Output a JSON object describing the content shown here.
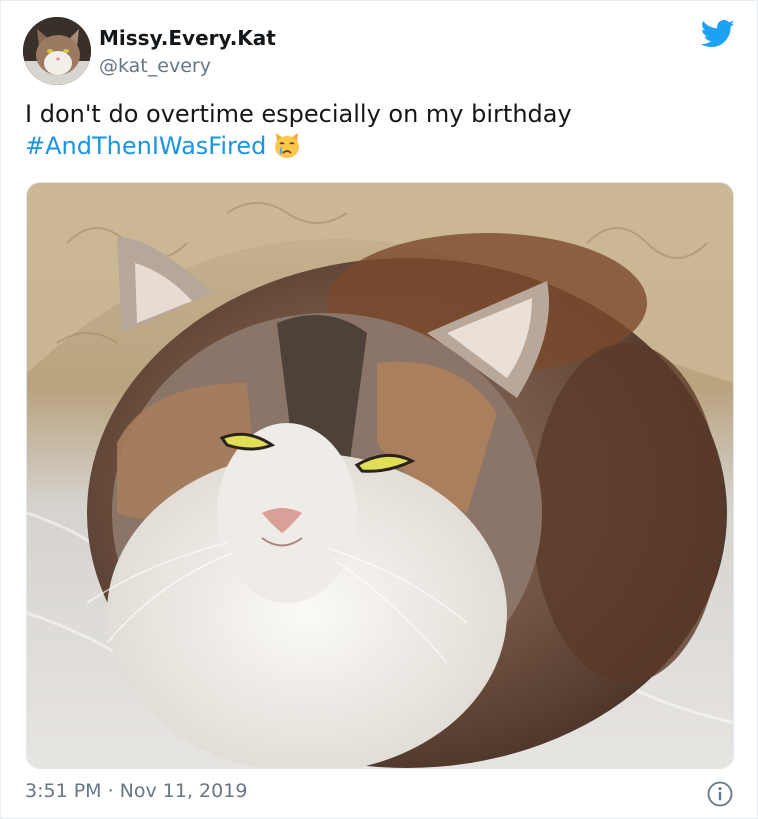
{
  "user": {
    "display_name": "Missy.Every.Kat",
    "handle": "@kat_every",
    "avatar_icon": "cat-avatar"
  },
  "tweet": {
    "text_line1": "I don't do overtime especially on my birthday",
    "hashtag": "#AndThenIWasFired",
    "emoji": "crying-cat-face",
    "media_icon": "calico-cat-photo",
    "timestamp": "3:51 PM · Nov 11, 2019"
  },
  "colors": {
    "brand": "#1da1f2",
    "hashtag": "#1b95e0",
    "text": "#14171a",
    "secondary": "#657786"
  },
  "icons": {
    "brand": "twitter-bird-icon",
    "info": "info-icon"
  }
}
